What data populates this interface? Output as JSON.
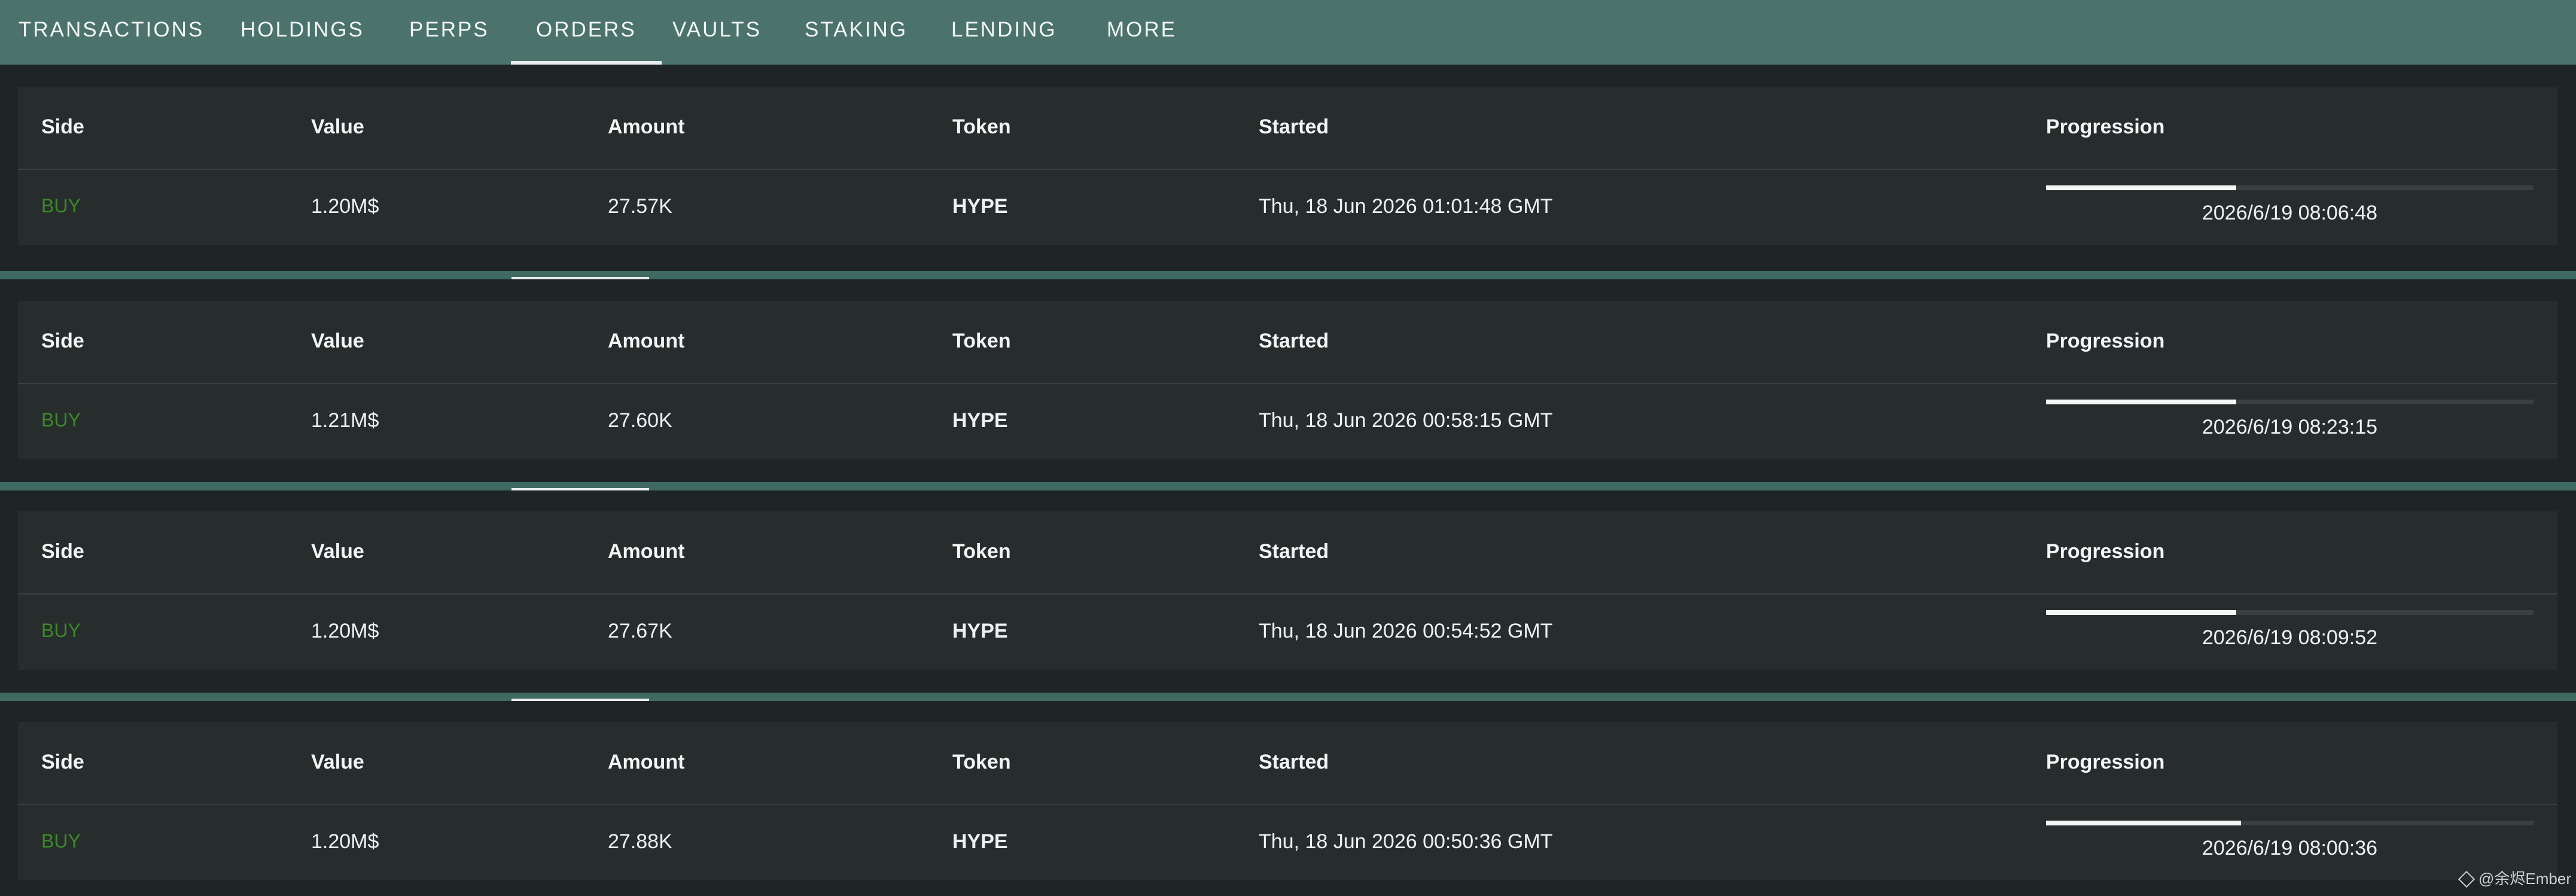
{
  "nav": {
    "tabs": [
      {
        "label": "TRANSACTIONS",
        "active": false
      },
      {
        "label": "HOLDINGS",
        "active": false
      },
      {
        "label": "PERPS",
        "active": false
      },
      {
        "label": "ORDERS",
        "active": true
      },
      {
        "label": "VAULTS",
        "active": false
      },
      {
        "label": "STAKING",
        "active": false
      },
      {
        "label": "LENDING",
        "active": false
      },
      {
        "label": "MORE",
        "active": false
      }
    ]
  },
  "table": {
    "headers": {
      "side": "Side",
      "value": "Value",
      "amount": "Amount",
      "token": "Token",
      "started": "Started",
      "progression": "Progression"
    }
  },
  "orders": [
    {
      "side": "BUY",
      "value": "1.20M$",
      "amount": "27.57K",
      "token": "HYPE",
      "started": "Thu, 18 Jun 2026 01:01:48 GMT",
      "progress_percent": 39,
      "end_time": "2026/6/19 08:06:48"
    },
    {
      "side": "BUY",
      "value": "1.21M$",
      "amount": "27.60K",
      "token": "HYPE",
      "started": "Thu, 18 Jun 2026 00:58:15 GMT",
      "progress_percent": 39,
      "end_time": "2026/6/19 08:23:15"
    },
    {
      "side": "BUY",
      "value": "1.20M$",
      "amount": "27.67K",
      "token": "HYPE",
      "started": "Thu, 18 Jun 2026 00:54:52 GMT",
      "progress_percent": 39,
      "end_time": "2026/6/19 08:09:52"
    },
    {
      "side": "BUY",
      "value": "1.20M$",
      "amount": "27.88K",
      "token": "HYPE",
      "started": "Thu, 18 Jun 2026 00:50:36 GMT",
      "progress_percent": 40,
      "end_time": "2026/6/19 08:00:36"
    }
  ],
  "watermark": {
    "text": "@余烬Ember"
  },
  "colors": {
    "nav_bg": "#4b736c",
    "page_bg": "#202727",
    "card_bg": "#272d2d",
    "buy": "#3c8a28",
    "progress_fill": "#f5f7f7",
    "progress_track": "#3a4040"
  }
}
